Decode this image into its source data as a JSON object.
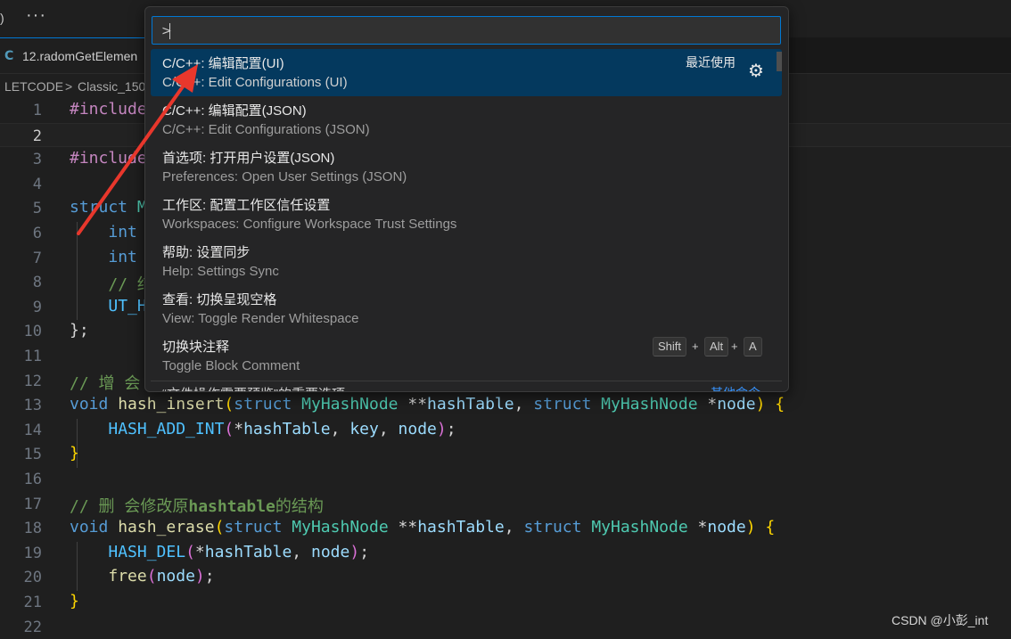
{
  "topbar": {
    "paren": ")",
    "more": "···"
  },
  "tab": {
    "icon_letter": "C",
    "label": "12.radomGetElemen"
  },
  "breadcrumb": {
    "root": "LETCODE",
    "sep": ">",
    "folder": "Classic_150"
  },
  "editor": {
    "active_line": 2,
    "line_numbers": [
      "1",
      "2",
      "3",
      "4",
      "5",
      "6",
      "7",
      "8",
      "9",
      "10",
      "11",
      "12",
      "13",
      "14",
      "15",
      "16",
      "17",
      "18",
      "19",
      "20",
      "21",
      "22"
    ],
    "l1_directive": "#include",
    "l3_directive": "#include",
    "l5_kw": "struct",
    "l5_type": "M",
    "l6_kw": "int",
    "l7_kw": "int",
    "l8_comment": "// 结",
    "l9_macro": "UT_H",
    "l10": "};",
    "l12_comment": "// 增 会",
    "l13": {
      "ret": "void",
      "fn": "hash_insert",
      "p1": "(",
      "s1": "struct",
      "t1": "MyHashNode",
      "ptr1": "**",
      "v1": "hashTable",
      "c1": ", ",
      "s2": "struct",
      "t2": "MyHashNode",
      "ptr2": "*",
      "v2": "node",
      "p2": ")",
      "b": "{"
    },
    "l14": {
      "macro": "HASH_ADD_INT",
      "p1": "(",
      "ptr": "*",
      "v1": "hashTable",
      "c1": ", ",
      "v2": "key",
      "c2": ", ",
      "v3": "node",
      "p2": ")",
      "semi": ";"
    },
    "l15": "}",
    "l17_comment_a": "// 删 会修改原",
    "l17_comment_b": "hashtable",
    "l17_comment_c": "的结构",
    "l18": {
      "ret": "void",
      "fn": "hash_erase",
      "p1": "(",
      "s1": "struct",
      "t1": "MyHashNode",
      "ptr1": "**",
      "v1": "hashTable",
      "c1": ", ",
      "s2": "struct",
      "t2": "MyHashNode",
      "ptr2": "*",
      "v2": "node",
      "p2": ")",
      "b": "{"
    },
    "l19": {
      "macro": "HASH_DEL",
      "p1": "(",
      "ptr": "*",
      "v1": "hashTable",
      "c1": ", ",
      "v2": "node",
      "p2": ")",
      "semi": ";"
    },
    "l20": {
      "fn": "free",
      "p1": "(",
      "v": "node",
      "p2": ")",
      "semi": ";"
    },
    "l21": "}"
  },
  "palette": {
    "input_value": ">",
    "items": [
      {
        "title": "C/C++: 编辑配置(UI)",
        "subtitle": "C/C++: Edit Configurations (UI)",
        "badge": "最近使用",
        "selected": true
      },
      {
        "title": "C/C++: 编辑配置(JSON)",
        "subtitle": "C/C++: Edit Configurations (JSON)"
      },
      {
        "title": "首选项: 打开用户设置(JSON)",
        "subtitle": "Preferences: Open User Settings (JSON)"
      },
      {
        "title": "工作区: 配置工作区信任设置",
        "subtitle": "Workspaces: Configure Workspace Trust Settings"
      },
      {
        "title": "帮助: 设置同步",
        "subtitle": "Help: Settings Sync"
      },
      {
        "title": "查看: 切换呈现空格",
        "subtitle": "View: Toggle Render Whitespace"
      },
      {
        "title": "切换块注释",
        "subtitle": "Toggle Block Comment",
        "keys": [
          "Shift",
          "Alt",
          "A"
        ]
      }
    ],
    "cutoff_text": "“文件操作需要预览”的重要选项",
    "cutoff_link": "其他命令"
  },
  "keys_plus": "+",
  "watermark": "CSDN @小彭_int",
  "colors": {
    "accent": "#0078d4",
    "selection": "#04395e",
    "annotation_arrow": "#e8372c"
  }
}
